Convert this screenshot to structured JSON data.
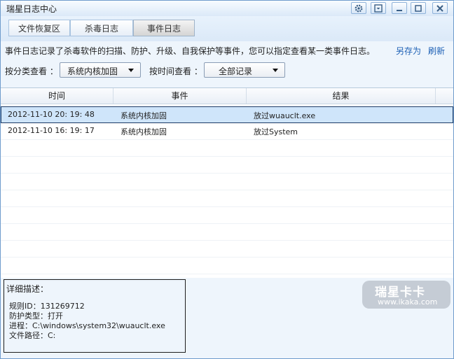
{
  "window": {
    "title": "瑞星日志中心"
  },
  "titlebar_icons": [
    "gear-icon",
    "menu-icon",
    "minimize-icon",
    "maximize-icon",
    "close-icon"
  ],
  "tabs": [
    {
      "label": "文件恢复区",
      "active": false
    },
    {
      "label": "杀毒日志",
      "active": false
    },
    {
      "label": "事件日志",
      "active": true
    }
  ],
  "description": "事件日志记录了杀毒软件的扫描、防护、升级、自我保护等事件，您可以指定查看某一类事件日志。",
  "actions": {
    "save_as": "另存为",
    "refresh": "刷新"
  },
  "filters": {
    "category_label": "按分类查看 ：",
    "category_value": "系统内核加固",
    "time_label": "按时间查看 ：",
    "time_value": "全部记录"
  },
  "table": {
    "columns": [
      "时间",
      "事件",
      "结果"
    ],
    "rows": [
      {
        "time": "2012-11-10 20: 19: 48",
        "event": "系统内核加固",
        "result": "放过wuauclt.exe",
        "selected": true
      },
      {
        "time": "2012-11-10 16: 19: 17",
        "event": "系统内核加固",
        "result": "放过System",
        "selected": false
      }
    ]
  },
  "detail": {
    "title": "详细描述：",
    "lines": [
      "规则ID：131269712",
      "防护类型：打开",
      "进程：C:\\windows\\system32\\wuauclt.exe",
      "文件路径：C:"
    ]
  },
  "watermark": {
    "brand": "瑞星卡卡",
    "url": "www.ikaka.com"
  },
  "colors": {
    "accent": "#1d60b5",
    "selected_row": "#cfe5fa",
    "background": "#eef5fc"
  }
}
